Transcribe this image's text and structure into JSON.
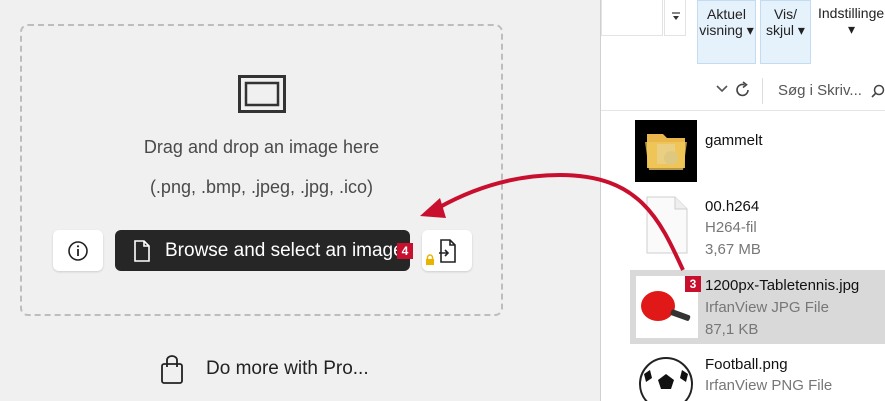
{
  "dropzone": {
    "text": "Drag and drop an image here",
    "formats": "(.png, .bmp, .jpeg, .jpg, .ico)",
    "browse_label": "Browse and select an image",
    "pro_label": "Do more with Pro..."
  },
  "badges": {
    "step3": "3",
    "step4": "4"
  },
  "ribbon": {
    "aktuel_line1": "Aktuel",
    "aktuel_line2": "visning",
    "vis_line1": "Vis/",
    "vis_line2": "skjul",
    "indstillinger": "Indstillinger"
  },
  "explorer": {
    "search_placeholder": "Søg i Skriv...",
    "files": [
      {
        "name": "gammelt",
        "type": "",
        "size": ""
      },
      {
        "name": "00.h264",
        "type": "H264-fil",
        "size": "3,67 MB"
      },
      {
        "name": "1200px-Tabletennis.jpg",
        "type": "IrfanView JPG File",
        "size": "87,1 KB"
      },
      {
        "name": "Football.png",
        "type": "IrfanView PNG File",
        "size": ""
      }
    ]
  },
  "colors": {
    "accent_red": "#c8102e",
    "primary_button": "#262626",
    "ribbon_bg": "#e5f1fb"
  }
}
